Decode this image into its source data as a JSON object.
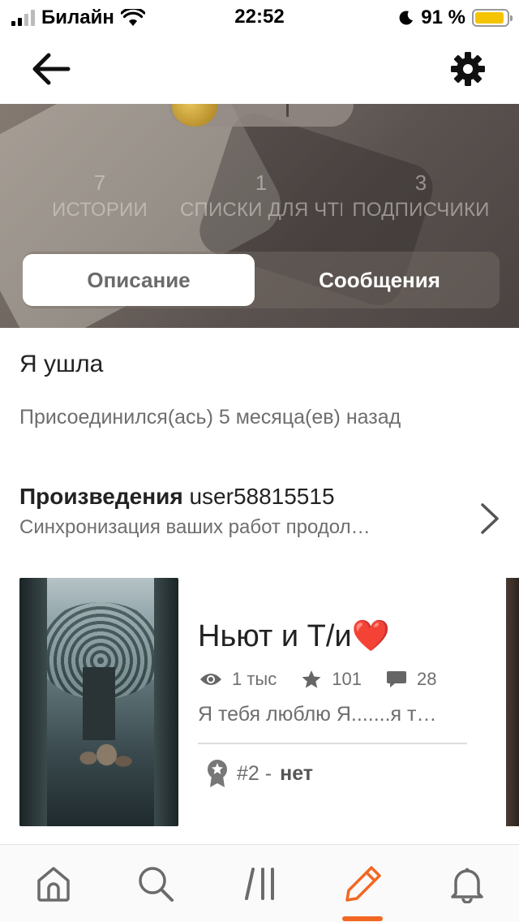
{
  "status_bar": {
    "carrier": "Билайн",
    "time": "22:52",
    "battery_percent": "91 %",
    "battery_level": 0.91,
    "battery_color": "#f5c400"
  },
  "top_nav": {
    "back_icon": "arrow-left-icon",
    "settings_icon": "gear-icon"
  },
  "profile_stats": [
    {
      "count": "7",
      "label": "ИСТОРИИ"
    },
    {
      "count": "1",
      "label": "СПИСКИ ДЛЯ ЧТЕ"
    },
    {
      "count": "3",
      "label": "ПОДПИСЧИКИ"
    }
  ],
  "tabs": {
    "description": "Описание",
    "messages": "Сообщения"
  },
  "about": {
    "text": "Я ушла",
    "joined": "Присоединился(ась) 5 месяца(ев) назад"
  },
  "works": {
    "title_prefix": "Произведения",
    "username": "user58815515",
    "subtitle": "Синхронизация ваших работ продол…"
  },
  "story": {
    "title": "Ньют и Т/и",
    "title_emoji": "❤️",
    "views": "1 тыс",
    "votes": "101",
    "comments": "28",
    "description": "Я тебя люблю  Я.......я т…",
    "rank_number": "#2 -",
    "rank_tag": "нет"
  },
  "bottom_nav": [
    {
      "name": "home-icon"
    },
    {
      "name": "search-icon"
    },
    {
      "name": "library-icon"
    },
    {
      "name": "write-pencil-icon",
      "active": true
    },
    {
      "name": "notifications-bell-icon"
    }
  ],
  "colors": {
    "accent": "#f26722",
    "text_primary": "#222222",
    "text_secondary": "#6e6e6e"
  }
}
